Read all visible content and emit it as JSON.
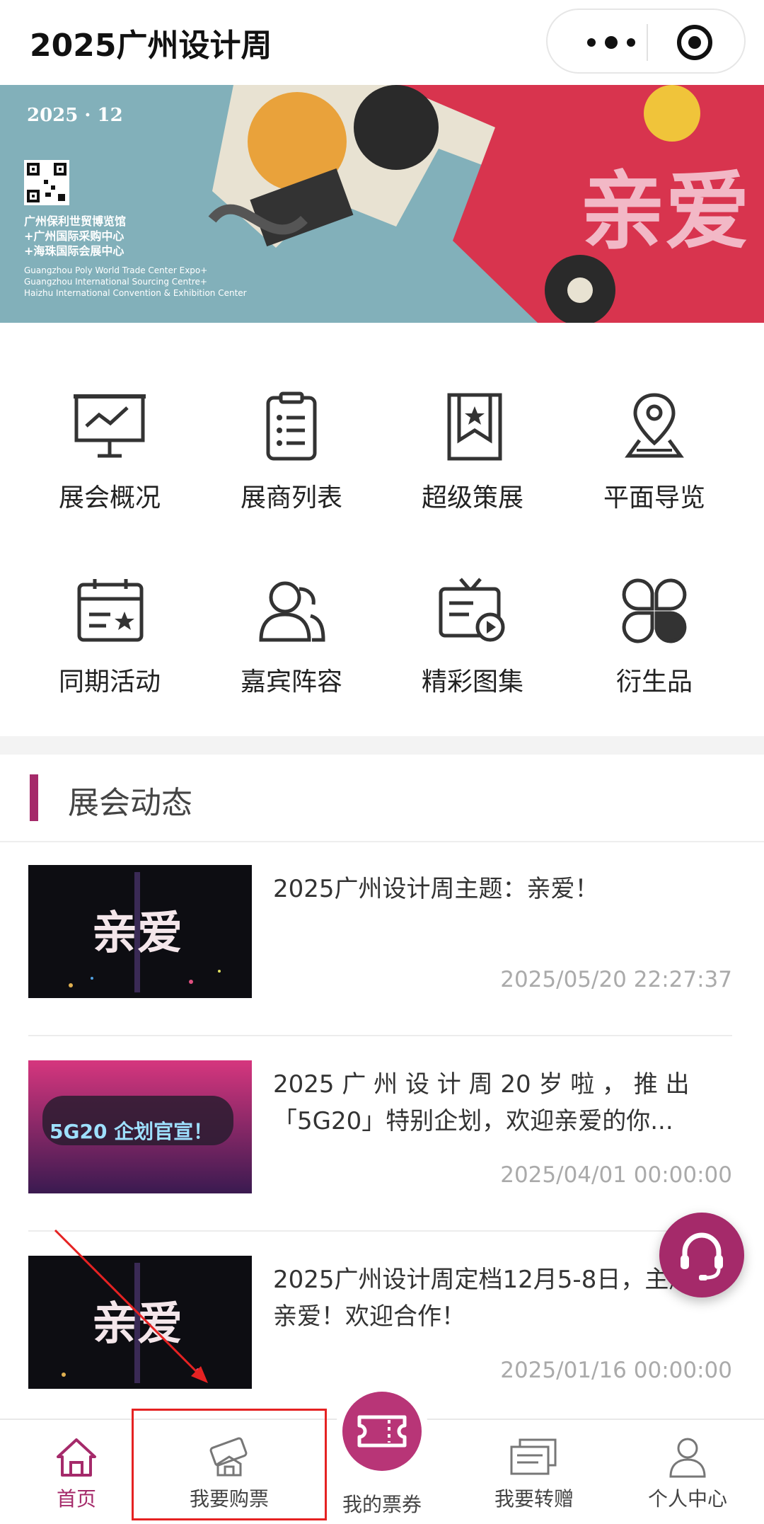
{
  "app": {
    "title": "2025广州设计周"
  },
  "capsule": {
    "more_icon": "more-dots-icon",
    "close_icon": "record-close-icon"
  },
  "banner": {
    "date_line": "2025 · 12",
    "venue_cn": [
      "广州保利世贸博览馆",
      "+广州国际采购中心",
      "+海珠国际会展中心"
    ],
    "venue_en": [
      "Guangzhou Poly World Trade Center Expo+",
      "Guangzhou International Sourcing Centre+",
      "Haizhu International Convention & Exhibition Center"
    ],
    "art_text": "亲爱",
    "colors": {
      "bg": "#82b0ba",
      "accent": "#d8344e"
    }
  },
  "grid": {
    "items": [
      {
        "label": "展会概况",
        "icon": "presentation-board-icon"
      },
      {
        "label": "展商列表",
        "icon": "clipboard-list-icon"
      },
      {
        "label": "超级策展",
        "icon": "bookmark-star-icon"
      },
      {
        "label": "平面导览",
        "icon": "map-pin-icon"
      },
      {
        "label": "同期活动",
        "icon": "calendar-star-icon"
      },
      {
        "label": "嘉宾阵容",
        "icon": "users-icon"
      },
      {
        "label": "精彩图集",
        "icon": "tv-play-icon"
      },
      {
        "label": "衍生品",
        "icon": "clover-icon"
      }
    ]
  },
  "news": {
    "section_title": "展会动态",
    "items": [
      {
        "title": "2025广州设计周主题：亲爱！",
        "time": "2025/05/20 22:27:37",
        "thumb_text": "亲爱"
      },
      {
        "title": "2025 广 州 设 计 周 20 岁 啦 ， 推 出 「5G20」特别企划，欢迎亲爱的你...",
        "time": "2025/04/01 00:00:00",
        "thumb_text": "5G20 企划官宣！"
      },
      {
        "title": "2025广州设计周定档12月5-8日，主题：亲爱！欢迎合作！",
        "time": "2025/01/16 00:00:00",
        "thumb_text": "亲爱"
      }
    ]
  },
  "float": {
    "icon": "headset-icon"
  },
  "tabbar": {
    "tabs": [
      {
        "label": "首页",
        "icon": "home-icon",
        "active": true
      },
      {
        "label": "我要购票",
        "icon": "ticket-buy-icon",
        "active": false
      },
      {
        "label": "我的票券",
        "icon": "ticket-icon",
        "active": false
      },
      {
        "label": "我要转赠",
        "icon": "ticket-transfer-icon",
        "active": false
      },
      {
        "label": "个人中心",
        "icon": "person-icon",
        "active": false
      }
    ],
    "accent": "#a52a6a"
  }
}
